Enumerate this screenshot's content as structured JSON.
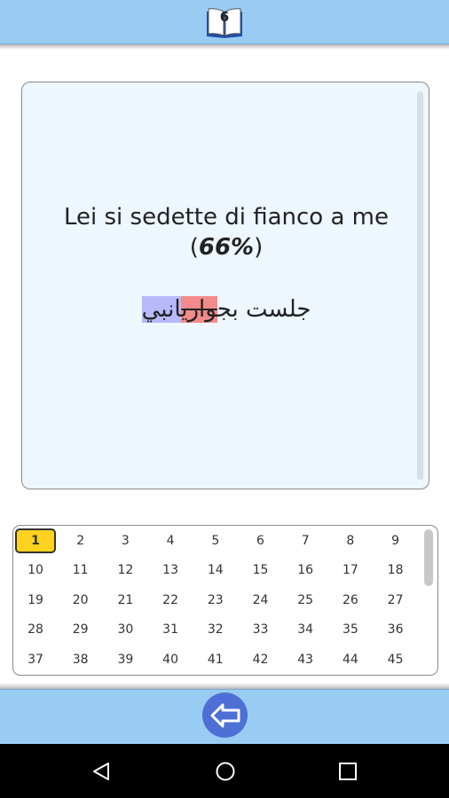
{
  "header": {
    "book_icon": "book-icon",
    "book_number": "6"
  },
  "card": {
    "sentence": "Lei si sedette di fianco a me",
    "percent_open": "(",
    "percent": "66%",
    "percent_close": ")",
    "answer_correct": "جلست بج",
    "answer_wrong": "واري",
    "answer_missing": "انبي"
  },
  "grid": {
    "active": "1",
    "numbers": [
      "1",
      "2",
      "3",
      "4",
      "5",
      "6",
      "7",
      "8",
      "9",
      "10",
      "11",
      "12",
      "13",
      "14",
      "15",
      "16",
      "17",
      "18",
      "19",
      "20",
      "21",
      "22",
      "23",
      "24",
      "25",
      "26",
      "27",
      "28",
      "29",
      "30",
      "31",
      "32",
      "33",
      "34",
      "35",
      "36",
      "37",
      "38",
      "39",
      "40",
      "41",
      "42",
      "43",
      "44",
      "45"
    ]
  },
  "footer": {
    "back_icon": "back-arrow-icon"
  },
  "nav": {
    "back": "nav-back-icon",
    "home": "nav-home-icon",
    "recents": "nav-recents-icon"
  },
  "colors": {
    "bar": "#99ccf2",
    "card": "#eef6fe",
    "wrong": "#f28b8b",
    "missing": "#b7b9fb",
    "active_cell": "#ffd21f",
    "button": "#4d6fd6"
  }
}
